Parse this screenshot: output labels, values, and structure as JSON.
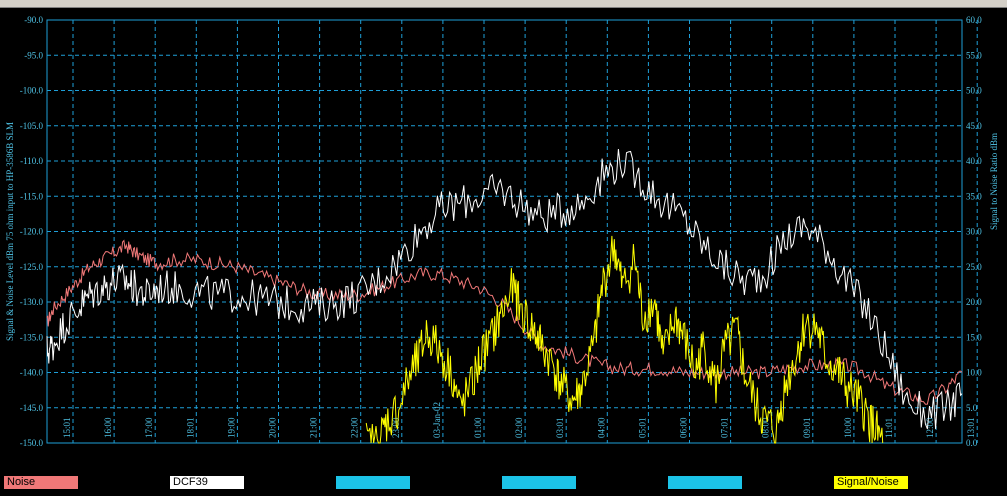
{
  "colors": {
    "background": "#000000",
    "grid": "#1E9FD8",
    "axis_text": "#4FC3E6",
    "noise": "#F07878",
    "dcf39": "#FFFFFF",
    "signal_noise": "#FFFF00",
    "legend_blank": "#1CC4E8"
  },
  "legend": [
    {
      "label": "Noise",
      "color": "#F07878"
    },
    {
      "label": "DCF39",
      "color": "#FFFFFF"
    },
    {
      "label": "",
      "color": "#1CC4E8"
    },
    {
      "label": "",
      "color": "#1CC4E8"
    },
    {
      "label": "",
      "color": "#1CC4E8"
    },
    {
      "label": "Signal/Noise",
      "color": "#FFFF00"
    }
  ],
  "chart_data": {
    "type": "line",
    "ylabel": "Signal & Noise Level dBm 75 ohm input to HP-3586B SLM",
    "y2label": "Signal to Noise Ratio  dBm",
    "ylim": [
      -150,
      -90
    ],
    "y2lim": [
      0,
      60
    ],
    "yticks": [
      "-90.0",
      "-95.0",
      "-100.0",
      "-105.0",
      "-110.0",
      "-115.0",
      "-120.0",
      "-125.0",
      "-130.0",
      "-135.0",
      "-140.0",
      "-145.0",
      "-150.0"
    ],
    "y2ticks": [
      "60.0",
      "55.0",
      "50.0",
      "45.0",
      "40.0",
      "35.0",
      "30.0",
      "25.0",
      "20.0",
      "15.0",
      "10.0",
      "5.0",
      "0.0"
    ],
    "xlim": [
      14.85,
      13.35
    ],
    "xticks": [
      "15:01",
      "16:00",
      "17:00",
      "18:01",
      "19:00",
      "20:00",
      "21:00",
      "22:00",
      "23:00",
      "03-Jan-02",
      "01:00",
      "02:00",
      "03:01",
      "04:00",
      "05:01",
      "06:00",
      "07:01",
      "08:00",
      "09:01",
      "10:00",
      "11:01",
      "12:00",
      "13:01"
    ],
    "grid": true,
    "series": [
      {
        "name": "Noise",
        "axis": "left",
        "x": [
          14.85,
          15.0,
          15.3,
          15.6,
          15.9,
          16.2,
          16.5,
          16.8,
          17.0,
          17.3,
          17.6,
          18.0,
          18.5,
          19.0,
          19.5,
          20.0,
          20.5,
          21.0,
          21.5,
          22.0,
          22.5,
          23.0,
          23.5,
          24.0,
          24.5,
          25.0,
          25.5,
          26.0,
          26.5,
          27.0,
          27.5,
          28.0,
          28.5,
          29.0,
          29.5,
          30.0,
          30.5,
          31.0,
          31.5,
          32.0,
          32.5,
          33.0,
          33.5,
          34.0,
          34.5,
          35.0,
          35.5,
          36.0,
          36.5,
          37.0,
          37.35
        ],
        "values": [
          -133,
          -131,
          -129,
          -127,
          -125,
          -124,
          -123,
          -122,
          -123,
          -124,
          -124.5,
          -124,
          -124,
          -124.5,
          -125,
          -126,
          -127,
          -128,
          -129,
          -129,
          -129,
          -128,
          -127,
          -126,
          -126,
          -127,
          -128,
          -130,
          -133,
          -136,
          -137,
          -138,
          -139,
          -139.5,
          -139.5,
          -139.5,
          -140,
          -140,
          -140,
          -140,
          -140,
          -139.5,
          -139,
          -139,
          -139,
          -140,
          -142,
          -143,
          -144,
          -142,
          -140
        ]
      },
      {
        "name": "DCF39",
        "axis": "left",
        "x": [
          14.85,
          15.0,
          15.3,
          15.6,
          15.9,
          16.2,
          16.5,
          16.8,
          17.0,
          17.3,
          17.6,
          18.0,
          18.5,
          19.0,
          19.5,
          20.0,
          20.5,
          21.0,
          21.5,
          22.0,
          22.5,
          23.0,
          23.5,
          24.0,
          24.5,
          25.0,
          25.5,
          26.0,
          26.5,
          27.0,
          27.5,
          28.0,
          28.5,
          29.0,
          29.5,
          30.0,
          30.5,
          31.0,
          31.5,
          32.0,
          32.5,
          33.0,
          33.5,
          34.0,
          34.5,
          35.0,
          35.5,
          36.0,
          36.5,
          37.0,
          37.35
        ],
        "values": [
          -137,
          -136,
          -133,
          -131,
          -129,
          -128,
          -127,
          -127,
          -128,
          -129,
          -128,
          -128,
          -128.5,
          -129,
          -129,
          -129.5,
          -130,
          -130.5,
          -130.5,
          -130,
          -129,
          -127,
          -124,
          -120,
          -117,
          -116,
          -115,
          -114,
          -116,
          -118,
          -117,
          -116,
          -112,
          -110,
          -113,
          -116,
          -118,
          -122,
          -125,
          -127,
          -126,
          -121,
          -119,
          -122,
          -127,
          -131,
          -137,
          -144,
          -146,
          -145,
          -143
        ]
      },
      {
        "name": "Signal/Noise",
        "axis": "right",
        "x": [
          22.7,
          23.0,
          23.2,
          23.5,
          23.8,
          24.0,
          24.2,
          24.5,
          24.8,
          25.0,
          25.3,
          25.5,
          25.8,
          26.0,
          26.3,
          26.5,
          26.8,
          27.0,
          27.3,
          27.5,
          27.8,
          28.0,
          28.3,
          28.5,
          28.8,
          29.0,
          29.3,
          29.5,
          29.8,
          30.0,
          30.3,
          30.5,
          30.8,
          31.0,
          31.3,
          31.5,
          31.8,
          32.0,
          32.3,
          32.5,
          32.8,
          33.0,
          33.3,
          33.5,
          33.8,
          34.0,
          34.3,
          34.5,
          34.8,
          35.0,
          35.2,
          35.4
        ],
        "values": [
          0,
          0,
          3,
          5,
          10,
          12,
          16,
          13,
          10,
          5,
          8,
          12,
          15,
          18,
          22,
          19,
          16,
          14,
          11,
          8,
          6,
          8,
          14,
          22,
          28,
          22,
          26,
          18,
          20,
          12,
          18,
          15,
          10,
          14,
          8,
          13,
          16,
          10,
          5,
          3,
          2,
          8,
          13,
          17,
          16,
          12,
          10,
          8,
          6,
          4,
          2,
          0
        ]
      }
    ]
  }
}
